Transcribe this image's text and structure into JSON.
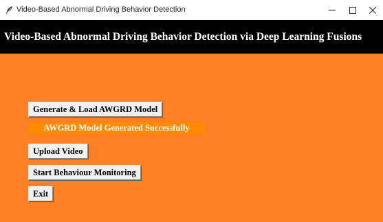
{
  "window": {
    "title": "Video-Based Abnormal Driving Behavior Detection",
    "app_icon": "feather-icon",
    "controls": {
      "minimize": "minimize-icon",
      "maximize": "maximize-icon",
      "close": "close-icon"
    }
  },
  "header": {
    "title": "Video-Based Abnormal Driving Behavior Detection via Deep Learning Fusions"
  },
  "main": {
    "buttons": {
      "generate_label": "Generate & Load AWGRD Model",
      "upload_label": "Upload Video",
      "monitor_label": "Start Behaviour Monitoring",
      "exit_label": "Exit"
    },
    "status_text": "AWGRD Model Generated Successfully"
  },
  "colors": {
    "background": "#FF7F24",
    "header_background": "#000000",
    "status_background": "#FF8C00",
    "status_text": "#FFFFFF"
  }
}
